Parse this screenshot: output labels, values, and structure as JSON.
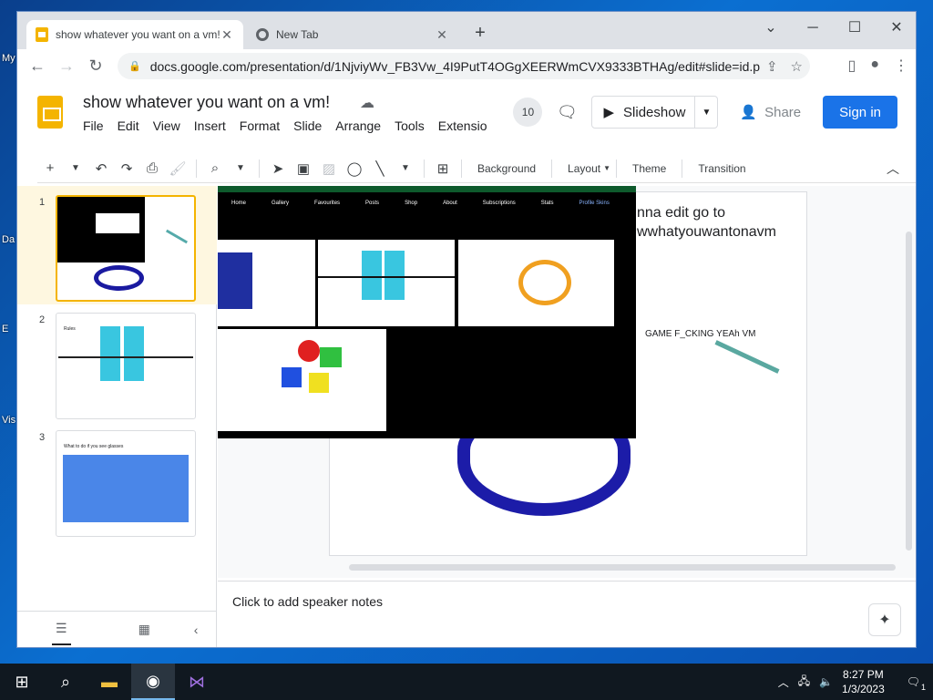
{
  "desktop": {
    "labels": [
      "My",
      "Da",
      "E",
      "Vis"
    ]
  },
  "browser": {
    "tabs": [
      {
        "title": "show whatever you want on a vm!",
        "active": true
      },
      {
        "title": "New Tab",
        "active": false
      }
    ],
    "url": "docs.google.com/presentation/d/1NjviyWv_FB3Vw_4I9PutT4OGgXEERWmCVX9333BTHAg/edit#slide=id.p"
  },
  "slides_app": {
    "title": "show whatever you want on a vm!",
    "menu": [
      "File",
      "Edit",
      "View",
      "Insert",
      "Format",
      "Slide",
      "Arrange",
      "Tools",
      "Extensio"
    ],
    "viewer_count": "10",
    "slideshow_label": "Slideshow",
    "share_label": "Share",
    "signin_label": "Sign in",
    "toolbar_text": [
      "Background",
      "Layout",
      "Theme",
      "Transition"
    ],
    "notes_placeholder": "Click to add speaker notes"
  },
  "slide_canvas": {
    "text_lines": [
      "nna edit go to",
      "wwhatyouwantonavm"
    ],
    "game_text": "GAME F_CKING YEAh VM",
    "pasted_nav": [
      "Home",
      "Gallery",
      "Favourites",
      "Posts",
      "Shop",
      "About",
      "Subscriptions",
      "Stats",
      "Profile Skins"
    ]
  },
  "filmstrip": {
    "slides": [
      {
        "number": "1"
      },
      {
        "number": "2",
        "title": "Rules"
      },
      {
        "number": "3",
        "title": "What to do if you see glasses"
      }
    ]
  },
  "taskbar": {
    "time": "8:27 PM",
    "date": "1/3/2023",
    "notification_count": "1"
  },
  "colors": {
    "accent": "#1a73e8",
    "slides_yellow": "#f4b400"
  }
}
